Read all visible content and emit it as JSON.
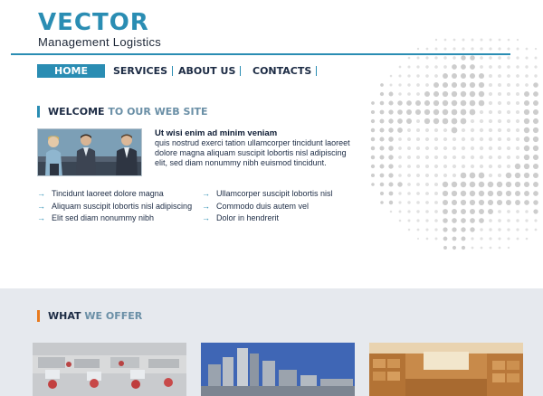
{
  "logo": {
    "title": "VECTOR",
    "subtitle": "Management Logistics"
  },
  "nav": {
    "items": [
      {
        "label": "HOME",
        "active": true
      },
      {
        "label": "SERVICES",
        "active": false
      },
      {
        "label": "ABOUT US",
        "active": false
      },
      {
        "label": "CONTACTS",
        "active": false
      }
    ]
  },
  "welcome": {
    "title_dark": "WELCOME",
    "title_light": "TO OUR WEB SITE",
    "heading": "Ut wisi enim ad minim veniam",
    "body": "quis nostrud exerci tation ullamcorper tincidunt laoreet dolore magna aliquam suscipit lobortis nisl adipiscing elit, sed diam nonummy nibh euismod tincidunt.",
    "list_left": [
      "Tincidunt laoreet dolore magna",
      "Aliquam suscipit lobortis nisl adipiscing",
      "Elit sed diam nonummy nibh"
    ],
    "list_right": [
      "Ullamcorper suscipit lobortis nisl",
      "Commodo duis autem vel",
      "Dolor in hendrerit"
    ]
  },
  "offer": {
    "title_dark": "WHAT",
    "title_light": "WE OFFER"
  },
  "icons": {
    "list_bullet": "arrow-right-icon"
  },
  "colors": {
    "brand": "#2a8db3",
    "navy": "#1c2b44",
    "offer_accent": "#e87a1e",
    "band": "#e6e9ee"
  }
}
